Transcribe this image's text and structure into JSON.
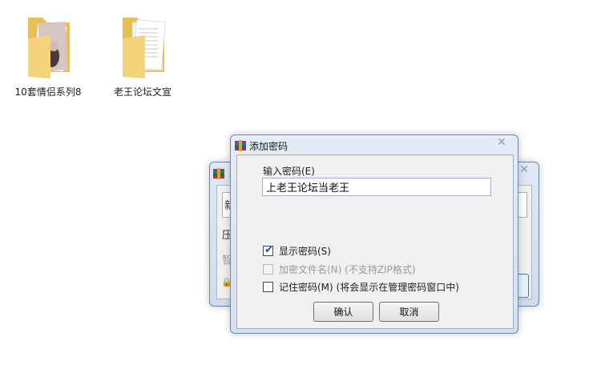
{
  "desktop": {
    "icons": [
      {
        "label": "10套情侣系列8"
      },
      {
        "label": "老王论坛文宣"
      }
    ]
  },
  "background_dialog": {
    "visible_chars": {
      "a": "新",
      "b": "压",
      "c": "智",
      "d": "🔒"
    }
  },
  "dialog": {
    "title": "添加密码",
    "password_label": "输入密码(E)",
    "password_value": "上老王论坛当老王",
    "options": {
      "show_password": {
        "label": "显示密码(S)",
        "checked": true
      },
      "encrypt_filenames": {
        "label": "加密文件名(N) (不支持ZIP格式)",
        "checked": false,
        "enabled": false
      },
      "remember_password": {
        "label": "记住密码(M) (将会显示在管理密码窗口中)",
        "checked": false
      }
    },
    "ok_label": "确认",
    "cancel_label": "取消"
  },
  "colors": {
    "accent": "#1f4fa0",
    "border": "#6f88a6"
  }
}
